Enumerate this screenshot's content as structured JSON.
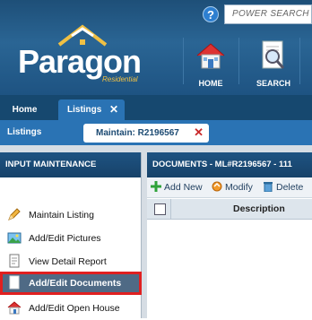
{
  "header": {
    "help_label": "?",
    "search_placeholder": "POWER SEARCH",
    "logo_text": "Paragon",
    "logo_sub": "Residential",
    "nav": [
      {
        "label": "HOME",
        "icon": "house-icon"
      },
      {
        "label": "SEARCH",
        "icon": "search-document-icon"
      }
    ]
  },
  "tabs": {
    "home": "Home",
    "listings": "Listings",
    "close": "✕"
  },
  "subbar": {
    "label": "Listings",
    "tab_label": "Maintain: R2196567",
    "close": "✕"
  },
  "left_panel": {
    "title": "INPUT MAINTENANCE",
    "items": [
      {
        "label": "Maintain Listing",
        "icon": "pencil-icon"
      },
      {
        "label": "Add/Edit Pictures",
        "icon": "picture-icon"
      },
      {
        "label": "View Detail Report",
        "icon": "report-icon"
      },
      {
        "label": "Add/Edit Documents",
        "icon": "document-icon",
        "selected": true
      },
      {
        "label": "Add/Edit Open House",
        "icon": "open-house-icon"
      }
    ]
  },
  "right_panel": {
    "title": "DOCUMENTS - ML#R2196567 - 111",
    "toolbar": {
      "add": "Add New",
      "modify": "Modify",
      "delete": "Delete"
    },
    "columns": [
      "Description"
    ]
  },
  "colors": {
    "header_blue": "#1e4f78",
    "tab_blue": "#2a73b4",
    "selected_item": "#4f6a85",
    "highlight_red": "#e02020"
  }
}
